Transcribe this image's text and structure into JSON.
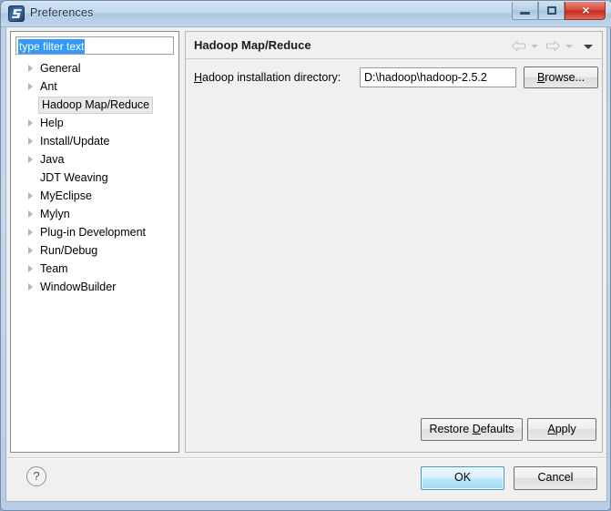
{
  "window": {
    "title": "Preferences",
    "app_icon": "eclipse-icon",
    "controls": {
      "minimize": "minimize-icon",
      "maximize": "restore-icon",
      "close": "×"
    }
  },
  "sidebar": {
    "filter": {
      "value": "type filter text",
      "placeholder": "type filter text",
      "selected": true
    },
    "items": [
      {
        "label": "General",
        "expandable": true,
        "selected": false
      },
      {
        "label": "Ant",
        "expandable": true,
        "selected": false
      },
      {
        "label": "Hadoop Map/Reduce",
        "expandable": false,
        "selected": true
      },
      {
        "label": "Help",
        "expandable": true,
        "selected": false
      },
      {
        "label": "Install/Update",
        "expandable": true,
        "selected": false
      },
      {
        "label": "Java",
        "expandable": true,
        "selected": false
      },
      {
        "label": "JDT Weaving",
        "expandable": false,
        "selected": false
      },
      {
        "label": "MyEclipse",
        "expandable": true,
        "selected": false
      },
      {
        "label": "Mylyn",
        "expandable": true,
        "selected": false
      },
      {
        "label": "Plug-in Development",
        "expandable": true,
        "selected": false
      },
      {
        "label": "Run/Debug",
        "expandable": true,
        "selected": false
      },
      {
        "label": "Team",
        "expandable": true,
        "selected": false
      },
      {
        "label": "WindowBuilder",
        "expandable": true,
        "selected": false
      }
    ]
  },
  "content": {
    "page_title": "Hadoop Map/Reduce",
    "nav": {
      "back": "back-arrow-icon",
      "back_menu": "chevron-down-icon",
      "forward": "forward-arrow-icon",
      "forward_menu": "chevron-down-icon",
      "view_menu": "chevron-down-icon"
    },
    "form": {
      "dir_label_prefix": "H",
      "dir_label_rest": "adoop installation directory:",
      "dir_value": "D:\\hadoop\\hadoop-2.5.2",
      "dir_placeholder": "",
      "browse_prefix": "B",
      "browse_rest": "rowse..."
    },
    "restore_defaults_prefix": "Restore ",
    "restore_defaults_mnemonic": "D",
    "restore_defaults_rest": "efaults",
    "apply_mnemonic": "A",
    "apply_rest": "pply"
  },
  "footer": {
    "help": "?",
    "ok": "OK",
    "cancel": "Cancel"
  },
  "colors": {
    "selection_blue": "#3399ff",
    "default_button_border": "#3c99cf",
    "close_button_red": "#c32a1c"
  }
}
